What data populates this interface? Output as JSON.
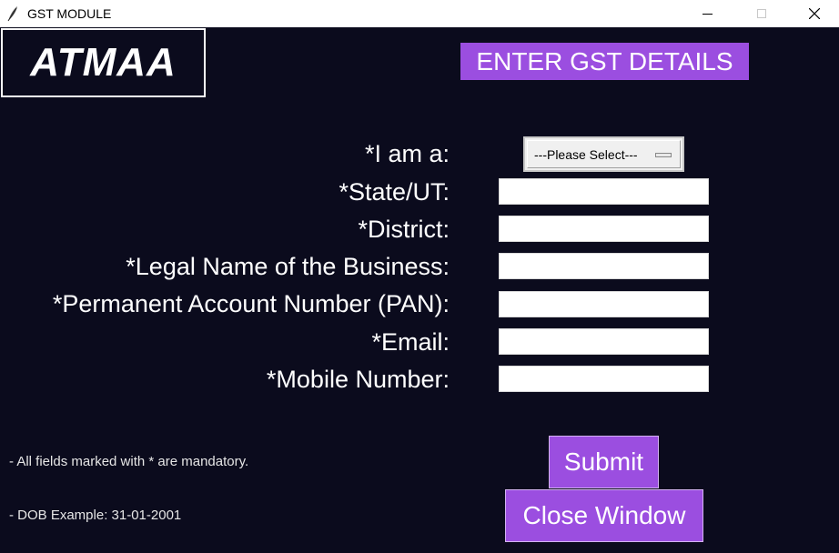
{
  "window": {
    "title": "GST MODULE",
    "app_icon": "feather-icon",
    "minimize_icon": "minimize-icon",
    "maximize_icon": "maximize-icon",
    "close_icon": "close-icon"
  },
  "logo": {
    "text": "ATMAA"
  },
  "heading": "ENTER GST DETAILS",
  "colors": {
    "background": "#0b0b1d",
    "accent": "#9b4ee0",
    "text": "#ffffff"
  },
  "form": {
    "role": {
      "label": "*I am a:",
      "selected": "---Please Select---"
    },
    "state": {
      "label": "*State/UT:",
      "value": ""
    },
    "district": {
      "label": "*District:",
      "value": ""
    },
    "legal_name": {
      "label": "*Legal Name of the Business:",
      "value": ""
    },
    "pan": {
      "label": "*Permanent Account Number (PAN):",
      "value": ""
    },
    "email": {
      "label": "*Email:",
      "value": ""
    },
    "mobile": {
      "label": "*Mobile Number:",
      "value": ""
    }
  },
  "notes": {
    "mandatory": "- All fields marked with * are mandatory.",
    "dob": "- DOB Example: 31-01-2001"
  },
  "buttons": {
    "submit": "Submit",
    "close": "Close Window"
  }
}
